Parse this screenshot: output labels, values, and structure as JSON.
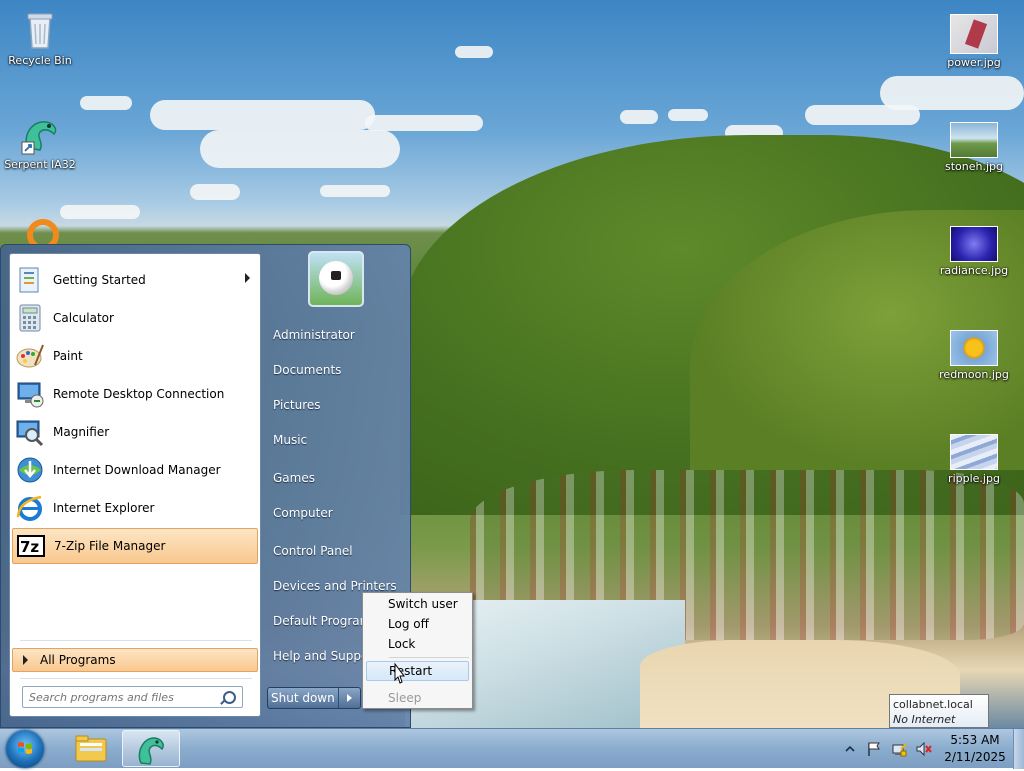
{
  "desktop": {
    "left_icons": [
      {
        "label": "Recycle Bin",
        "icon": "recycle-bin-icon"
      },
      {
        "label": "Serpent IA32",
        "icon": "serpent-icon"
      }
    ],
    "right_icons": [
      {
        "label": "power.jpg",
        "icon": "image-file-icon"
      },
      {
        "label": "stoneh.jpg",
        "icon": "image-file-icon"
      },
      {
        "label": "radiance.jpg",
        "icon": "image-file-icon"
      },
      {
        "label": "redmoon.jpg",
        "icon": "image-file-icon"
      },
      {
        "label": "ripple.jpg",
        "icon": "image-file-icon"
      }
    ]
  },
  "start_menu": {
    "programs": [
      {
        "label": "Getting Started",
        "icon": "getting-started-icon",
        "has_submenu": true
      },
      {
        "label": "Calculator",
        "icon": "calculator-icon"
      },
      {
        "label": "Paint",
        "icon": "paint-icon"
      },
      {
        "label": "Remote Desktop Connection",
        "icon": "remote-desktop-icon"
      },
      {
        "label": "Magnifier",
        "icon": "magnifier-icon"
      },
      {
        "label": "Internet Download Manager",
        "icon": "idm-icon"
      },
      {
        "label": "Internet Explorer",
        "icon": "internet-explorer-icon"
      },
      {
        "label": "7-Zip File Manager",
        "icon": "7zip-icon",
        "highlighted": true
      }
    ],
    "all_programs": "All Programs",
    "search_placeholder": "Search programs and files",
    "right_links": [
      "Administrator",
      "Documents",
      "Pictures",
      "Music",
      "Games",
      "Computer",
      "Control Panel",
      "Devices and Printers",
      "Default Programs",
      "Help and Support"
    ],
    "shutdown_label": "Shut down"
  },
  "shutdown_submenu": {
    "items": [
      "Switch user",
      "Log off",
      "Lock",
      "Restart",
      "Sleep"
    ],
    "highlighted": "Restart",
    "disabled": "Sleep"
  },
  "taskbar": {
    "clock_time": "5:53 AM",
    "clock_date": "2/11/2025"
  },
  "network_tooltip": {
    "line1": "collabnet.local",
    "line2": "No Internet access"
  }
}
